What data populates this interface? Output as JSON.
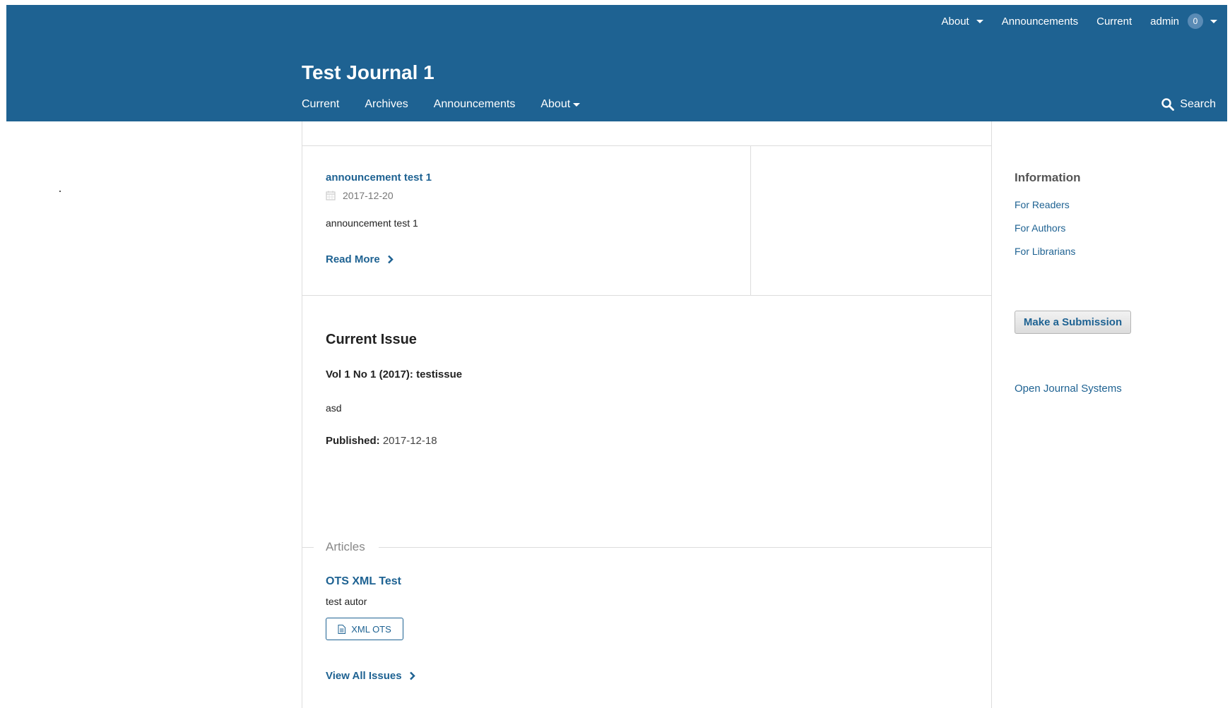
{
  "user_nav": {
    "about": "About",
    "announcements": "Announcements",
    "current": "Current",
    "admin": "admin",
    "notification_count": "0"
  },
  "site_title": "Test Journal 1",
  "primary_nav": {
    "current": "Current",
    "archives": "Archives",
    "announcements": "Announcements",
    "about": "About"
  },
  "search": {
    "label": "Search"
  },
  "announcement": {
    "title": "announcement test 1",
    "date": "2017-12-20",
    "summary": "announcement test 1",
    "read_more": "Read More"
  },
  "current_issue": {
    "heading": "Current Issue",
    "identification": "Vol 1 No 1 (2017): testissue",
    "description": "asd",
    "published_label": "Published:",
    "published_date": "2017-12-18",
    "articles_label": "Articles",
    "articles": [
      {
        "title": "OTS XML Test",
        "author": "test autor",
        "galley": "XML OTS"
      }
    ],
    "view_all": "View All Issues"
  },
  "sidebar": {
    "info_title": "Information",
    "links": [
      "For Readers",
      "For Authors",
      "For Librarians"
    ],
    "submit": "Make a Submission",
    "ojs": "Open Journal Systems"
  },
  "colors": {
    "header_bg": "#1e6292",
    "link": "#1e6292"
  }
}
